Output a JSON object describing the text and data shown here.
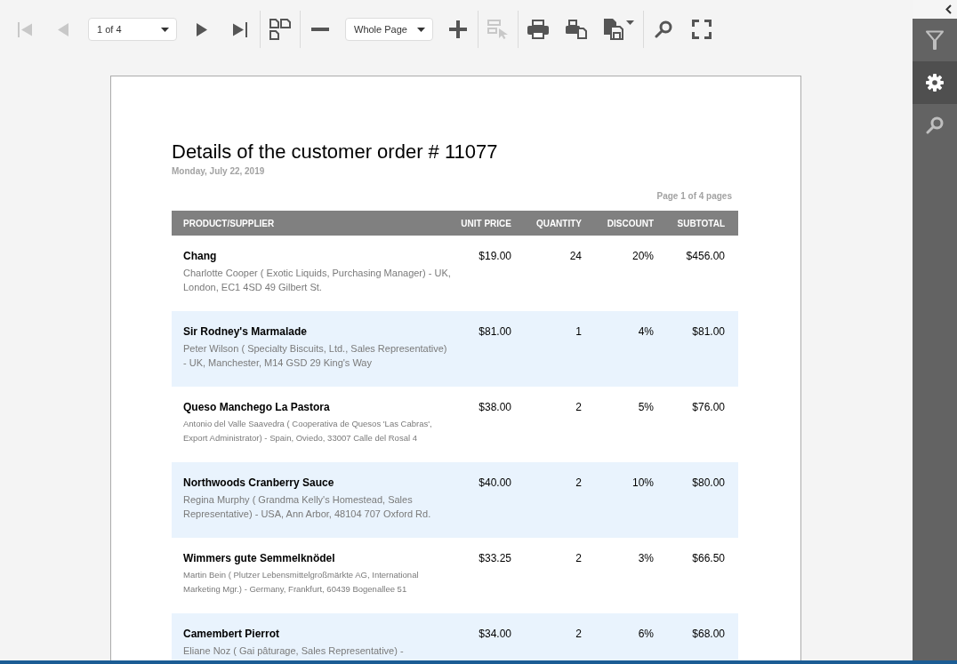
{
  "toolbar": {
    "groups": [
      [
        {
          "kind": "first-page",
          "disabled": true
        },
        {
          "kind": "previous-page",
          "disabled": true
        },
        {
          "kind": "page-select",
          "value": "1 of 4",
          "disabled": false
        },
        {
          "kind": "next-page",
          "disabled": false
        },
        {
          "kind": "last-page",
          "disabled": false
        }
      ],
      [
        {
          "kind": "multi-page",
          "disabled": false
        }
      ],
      [
        {
          "kind": "zoom-out",
          "disabled": false
        },
        {
          "kind": "zoom-select",
          "value": "Whole Page",
          "disabled": false
        },
        {
          "kind": "zoom-in",
          "disabled": false
        }
      ],
      [
        {
          "kind": "select-tool",
          "disabled": true
        }
      ],
      [
        {
          "kind": "print",
          "disabled": false
        },
        {
          "kind": "print-page",
          "disabled": false
        },
        {
          "kind": "export",
          "disabled": false
        }
      ],
      [
        {
          "kind": "search",
          "disabled": false
        },
        {
          "kind": "full-screen",
          "disabled": false
        }
      ]
    ]
  },
  "side_panel": {
    "tabs": [
      {
        "kind": "filter",
        "selected": false
      },
      {
        "kind": "settings",
        "selected": true
      },
      {
        "kind": "search",
        "selected": false
      }
    ]
  },
  "report": {
    "title": "Details of the customer order # 11077",
    "date": "Monday, July 22, 2019",
    "page_info": "Page 1 of 4 pages",
    "table": {
      "columns": [
        "PRODUCT/SUPPLIER",
        "UNIT PRICE",
        "QUANTITY",
        "DISCOUNT",
        "SUBTOTAL"
      ],
      "rows": [
        {
          "product": "Chang",
          "supplier": "Charlotte Cooper ( Exotic Liquids, Purchasing Manager) - UK, London, EC1 4SD 49 Gilbert St.",
          "unit_price": "$19.00",
          "quantity": "24",
          "discount": "20%",
          "subtotal": "$456.00"
        },
        {
          "product": "Sir Rodney's Marmalade",
          "supplier": "Peter Wilson ( Specialty Biscuits, Ltd., Sales Representative) - UK, Manchester, M14 GSD 29 King's Way",
          "unit_price": "$81.00",
          "quantity": "1",
          "discount": "4%",
          "subtotal": "$81.00"
        },
        {
          "product": "Queso Manchego La Pastora",
          "supplier": "Antonio del Valle Saavedra ( Cooperativa de Quesos 'Las Cabras', Export Administrator) - Spain, Oviedo, 33007 Calle del Rosal 4",
          "unit_price": "$38.00",
          "quantity": "2",
          "discount": "5%",
          "subtotal": "$76.00"
        },
        {
          "product": "Northwoods Cranberry Sauce",
          "supplier": "Regina Murphy ( Grandma Kelly's Homestead, Sales Representative) - USA, Ann Arbor, 48104 707 Oxford Rd.",
          "unit_price": "$40.00",
          "quantity": "2",
          "discount": "10%",
          "subtotal": "$80.00"
        },
        {
          "product": "Wimmers gute Semmelknödel",
          "supplier": "Martin Bein ( Plutzer Lebensmittelgroßmärkte AG, International Marketing Mgr.) - Germany, Frankfurt, 60439 Bogenallee 51",
          "unit_price": "$33.25",
          "quantity": "2",
          "discount": "3%",
          "subtotal": "$66.50"
        },
        {
          "product": "Camembert Pierrot",
          "supplier": "Eliane Noz ( Gai pâturage, Sales Representative) -",
          "unit_price": "$34.00",
          "quantity": "2",
          "discount": "6%",
          "subtotal": "$68.00"
        }
      ]
    }
  }
}
